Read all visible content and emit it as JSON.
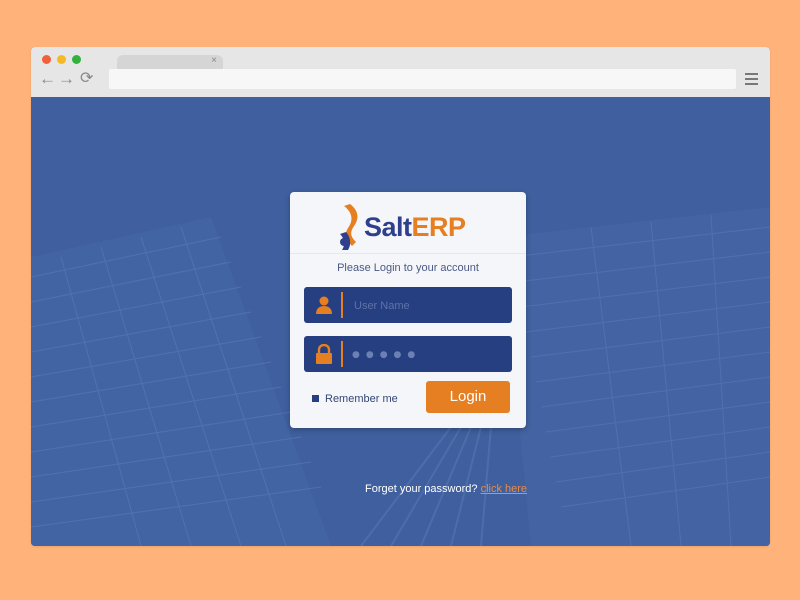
{
  "browser": {
    "tab_close": "×",
    "menu_icon": "hamburger-menu-icon"
  },
  "logo": {
    "brand_part1": "Salt",
    "brand_part2": "ERP"
  },
  "login": {
    "subtitle": "Please Login to your account",
    "username_placeholder": "User Name",
    "password_mask": "●●●●●",
    "remember_label": "Remember me",
    "login_button": "Login",
    "forgot_text": "Forget your password?",
    "forgot_link": "click here"
  },
  "colors": {
    "page_background": "#FFB27A",
    "hero_blue": "#3F5F9E",
    "field_blue": "#253F81",
    "accent_orange": "#E67E22"
  }
}
